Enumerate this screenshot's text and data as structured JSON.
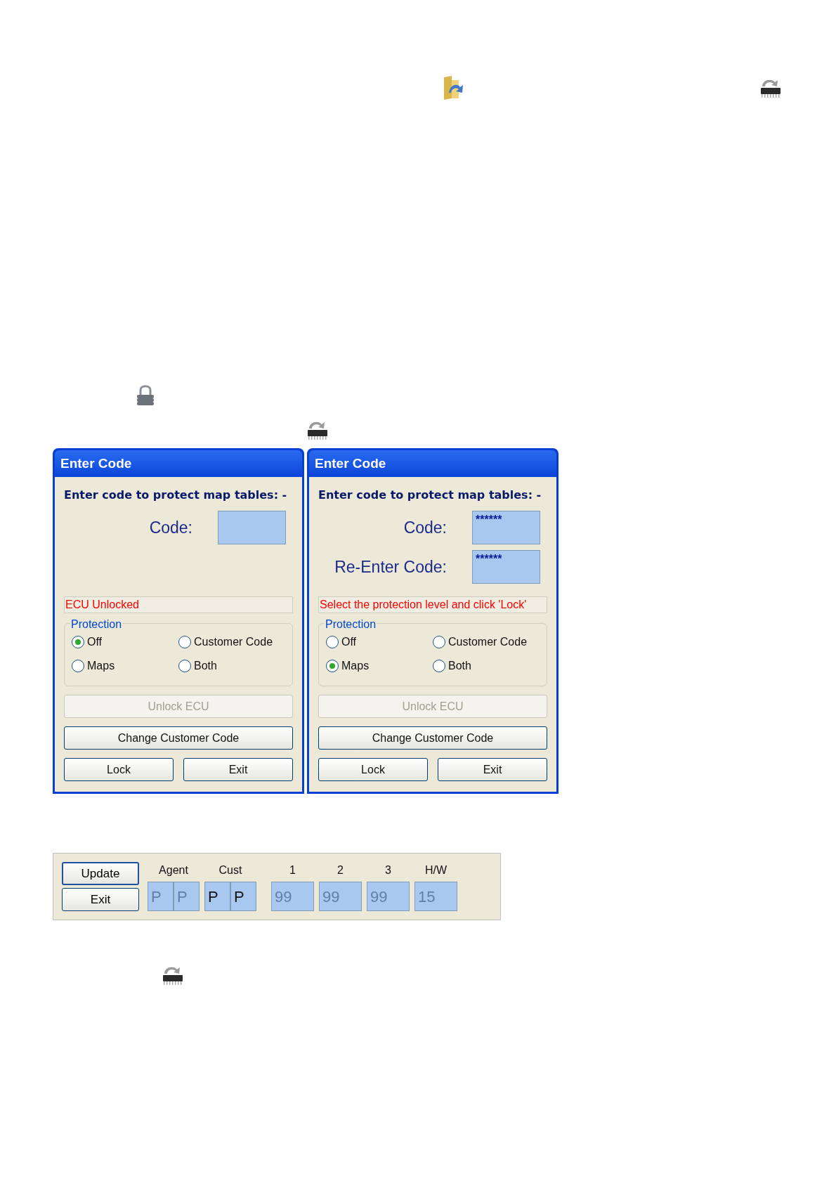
{
  "dialogs": [
    {
      "title": "Enter Code",
      "prompt": "Enter code to protect map tables: -",
      "fields": [
        {
          "label": "Code:"
        }
      ],
      "status": "ECU Unlocked",
      "group_title": "Protection",
      "options": [
        {
          "label": "Off",
          "selected": true
        },
        {
          "label": "Customer Code",
          "selected": false
        },
        {
          "label": "Maps",
          "selected": false
        },
        {
          "label": "Both",
          "selected": false
        }
      ],
      "buttons": [
        {
          "label": "Unlock ECU",
          "kind": "wide",
          "disabled": true
        },
        {
          "label": "Change Customer Code",
          "kind": "wide",
          "disabled": false
        },
        {
          "label": "Lock",
          "kind": "half",
          "disabled": false
        },
        {
          "label": "Exit",
          "kind": "half",
          "disabled": false
        }
      ]
    },
    {
      "title": "Enter Code",
      "prompt": "Enter code to protect map tables: -",
      "fields": [
        {
          "label": "Code:",
          "value": "******"
        },
        {
          "label": "Re-Enter Code:",
          "value": "******"
        }
      ],
      "status": "Select the protection level and click 'Lock'",
      "group_title": "Protection",
      "options": [
        {
          "label": "Off",
          "selected": false
        },
        {
          "label": "Customer Code",
          "selected": false
        },
        {
          "label": "Maps",
          "selected": true
        },
        {
          "label": "Both",
          "selected": false
        }
      ],
      "buttons": [
        {
          "label": "Unlock ECU",
          "kind": "wide",
          "disabled": true
        },
        {
          "label": "Change Customer Code",
          "kind": "wide",
          "disabled": false
        },
        {
          "label": "Lock",
          "kind": "half",
          "disabled": false
        },
        {
          "label": "Exit",
          "kind": "half",
          "disabled": false
        }
      ]
    }
  ],
  "toolbar": {
    "buttons": [
      "Update",
      "Exit"
    ],
    "groups": [
      {
        "label": "Agent",
        "cells": [
          {
            "value": "P",
            "disabled": true
          },
          {
            "value": "P",
            "disabled": true
          }
        ]
      },
      {
        "label": "Cust",
        "cells": [
          {
            "value": "P",
            "disabled": false
          },
          {
            "value": "P",
            "disabled": false
          }
        ]
      },
      {
        "label": "1",
        "cells": [
          {
            "value": "99",
            "disabled": true
          }
        ]
      },
      {
        "label": "2",
        "cells": [
          {
            "value": "99",
            "disabled": true
          }
        ]
      },
      {
        "label": "3",
        "cells": [
          {
            "value": "99",
            "disabled": true
          }
        ]
      },
      {
        "label": "H/W",
        "cells": [
          {
            "value": "15",
            "disabled": true
          }
        ]
      }
    ]
  }
}
